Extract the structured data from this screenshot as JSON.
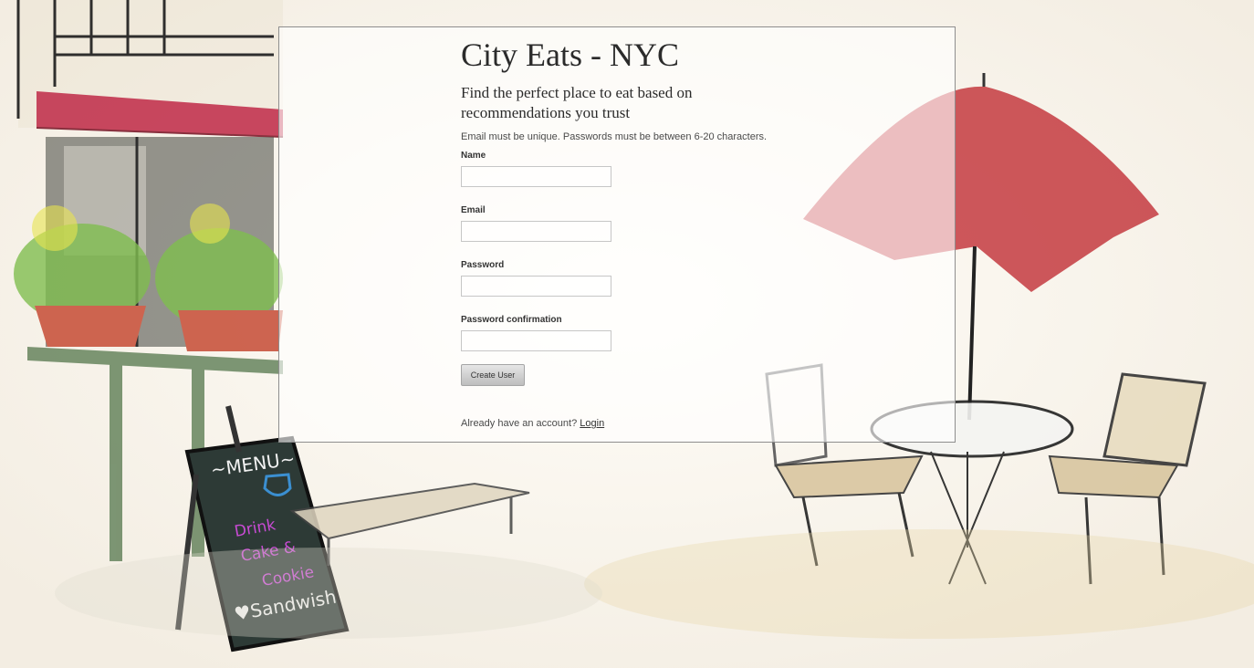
{
  "page": {
    "title": "City Eats - NYC",
    "tagline": "Find the perfect place to eat based on recommendations you trust",
    "notice": "Email must be unique. Passwords must be between 6-20 characters."
  },
  "form": {
    "fields": [
      {
        "label": "Name",
        "value": "",
        "type": "text"
      },
      {
        "label": "Email",
        "value": "",
        "type": "text"
      },
      {
        "label": "Password",
        "value": "",
        "type": "password"
      },
      {
        "label": "Password confirmation",
        "value": "",
        "type": "password"
      }
    ],
    "submit_label": "Create User"
  },
  "footer": {
    "prompt": "Already have an account?",
    "login_link": "Login"
  },
  "background": {
    "scene": "watercolor cafe illustration",
    "menu_board": [
      "~MENU~",
      "Drink",
      "Cake &",
      "Cookie",
      "Sandwish"
    ]
  }
}
